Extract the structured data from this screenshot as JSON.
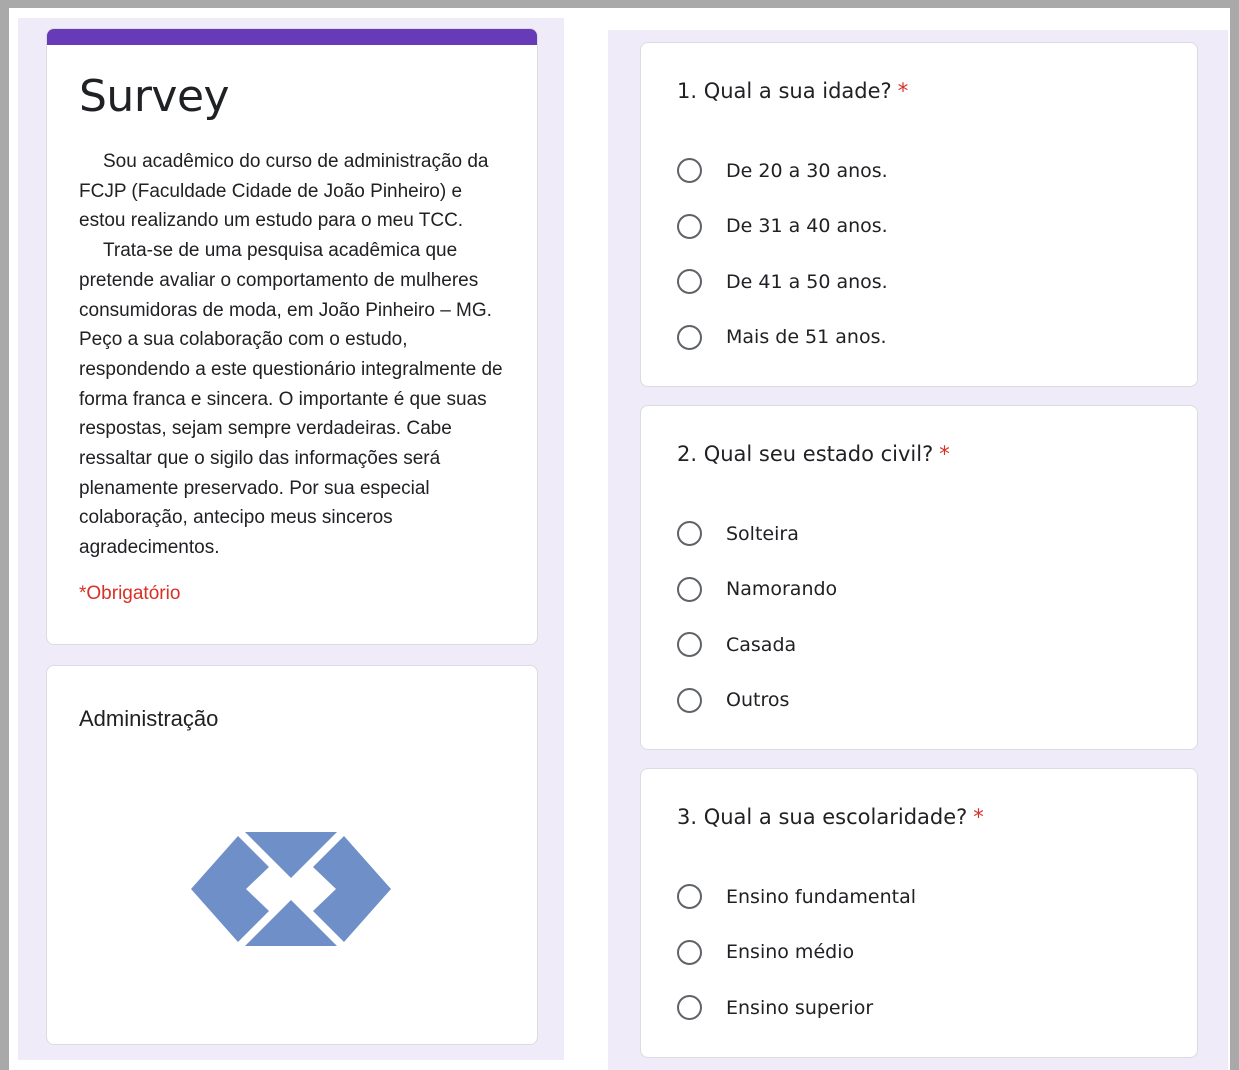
{
  "form": {
    "title": "Survey",
    "description": [
      "Sou acadêmico do curso de administração da FCJP (Faculdade Cidade de João Pinheiro) e estou realizando um estudo para o meu TCC.",
      "Trata-se de uma pesquisa acadêmica que pretende avaliar o comportamento de mulheres consumidoras de moda, em João Pinheiro – MG. Peço a sua colaboração com o estudo, respondendo a este questionário integralmente de forma franca e sincera. O importante é que suas respostas, sejam sempre verdadeiras. Cabe ressaltar que o sigilo das informações será plenamente preservado. Por sua especial colaboração, antecipo meus sinceros agradecimentos."
    ],
    "required_note": "*Obrigatório",
    "accent_color": "#673ab7"
  },
  "section": {
    "title": "Administração",
    "logo_color": "#6f8fc8",
    "logo_icon": "diamond-chevrons-logo"
  },
  "questions": [
    {
      "title": "1. Qual a sua idade?",
      "required_mark": "*",
      "options": [
        "De 20 a 30 anos.",
        "De 31 a 40 anos.",
        "De 41 a 50 anos.",
        "Mais de 51 anos."
      ]
    },
    {
      "title": "2. Qual seu estado civil?",
      "required_mark": "*",
      "options": [
        "Solteira",
        "Namorando",
        "Casada",
        "Outros"
      ]
    },
    {
      "title": "3. Qual a sua escolaridade?",
      "required_mark": "*",
      "options": [
        "Ensino fundamental",
        "Ensino médio",
        "Ensino superior"
      ]
    }
  ]
}
